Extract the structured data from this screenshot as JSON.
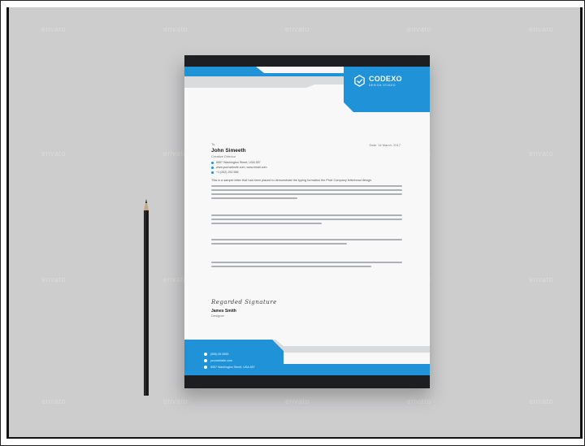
{
  "watermark_text": "envato",
  "colors": {
    "background": "#cdcdce",
    "paper": "#f8f8f9",
    "accent": "#1f92d8",
    "dark": "#1c1e22",
    "grey_band": "#dadbdd"
  },
  "letterhead": {
    "brand": "CODEXO",
    "tagline": "DESIGN STUDIO",
    "to_label": "To,",
    "recipient_name": "John Simeeth",
    "recipient_role": "Creative Director",
    "date": "Date: 14 March, 2017",
    "address_lines": [
      "5557 Washington Street, USA 557",
      "www.yourwebsite.com, www.email.com",
      "+1 (252) 252 556"
    ],
    "first_line": "This is a sample letter that has been placed to demonstrate the typing formation the Phar Company letterhead design.",
    "paragraphs": [
      {
        "lines": 4
      },
      {
        "lines": 3
      },
      {
        "lines": 2
      },
      {
        "lines": 2
      }
    ],
    "signature_script": "Regarded Signature",
    "signer_name": "James Smith",
    "signer_role": "Designer",
    "footer_contacts": [
      "(555) 55 5555",
      "yourwebsite.com",
      "5557 Washington Street, USA 557"
    ]
  }
}
